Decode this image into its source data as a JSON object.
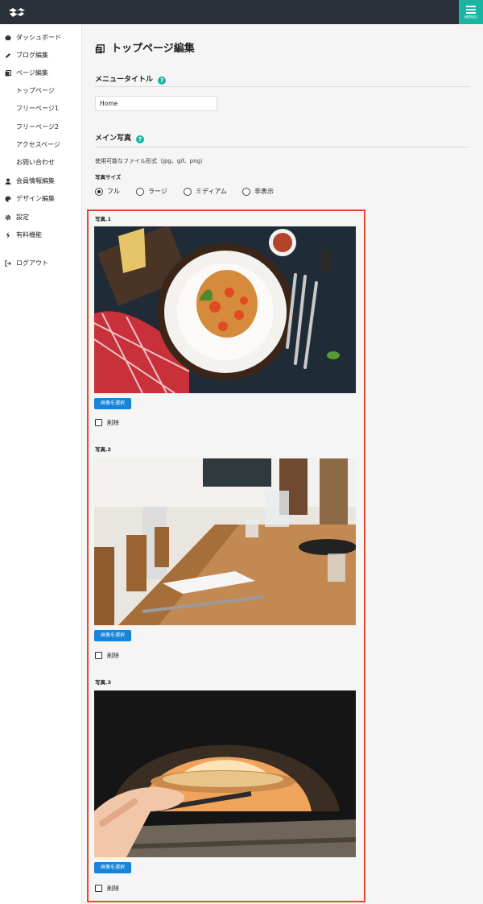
{
  "header": {
    "menu_label": "MENU"
  },
  "sidebar": {
    "items": [
      {
        "label": "ダッシュボード",
        "icon": "dashboard-icon"
      },
      {
        "label": "ブログ編集",
        "icon": "pencil-icon"
      },
      {
        "label": "ページ編集",
        "icon": "pages-icon"
      },
      {
        "label": "トップページ"
      },
      {
        "label": "フリーページ1"
      },
      {
        "label": "フリーページ2"
      },
      {
        "label": "アクセスページ"
      },
      {
        "label": "お問い合わせ"
      },
      {
        "label": "会員情報編集",
        "icon": "user-icon"
      },
      {
        "label": "デザイン編集",
        "icon": "palette-icon"
      },
      {
        "label": "設定",
        "icon": "gear-icon"
      },
      {
        "label": "有料機能",
        "icon": "bolt-icon"
      },
      {
        "label": "ログアウト",
        "icon": "logout-icon"
      }
    ]
  },
  "page": {
    "title": "トップページ編集",
    "menu_title": {
      "label": "メニュータイトル",
      "value": "Home"
    },
    "main_photo": {
      "label": "メイン写真",
      "formats_note": "使用可能なファイル形式（jpg、gif、png）",
      "size_label": "写真サイズ",
      "sizes": [
        "フル",
        "ラージ",
        "ミディアム",
        "非表示"
      ],
      "selected_size": "フル"
    },
    "photos": [
      {
        "label": "写真.1",
        "select_label": "画像を選択",
        "delete_label": "削除",
        "scene": "pasta"
      },
      {
        "label": "写真.2",
        "select_label": "画像を選択",
        "delete_label": "削除",
        "scene": "restaurant"
      },
      {
        "label": "写真.3",
        "select_label": "画像を選択",
        "delete_label": "削除",
        "scene": "pizza-oven"
      }
    ]
  },
  "colors": {
    "topbar": "#2b313a",
    "accent": "#19b5a3",
    "button": "#1684d8",
    "highlight_border": "#e2482b"
  }
}
